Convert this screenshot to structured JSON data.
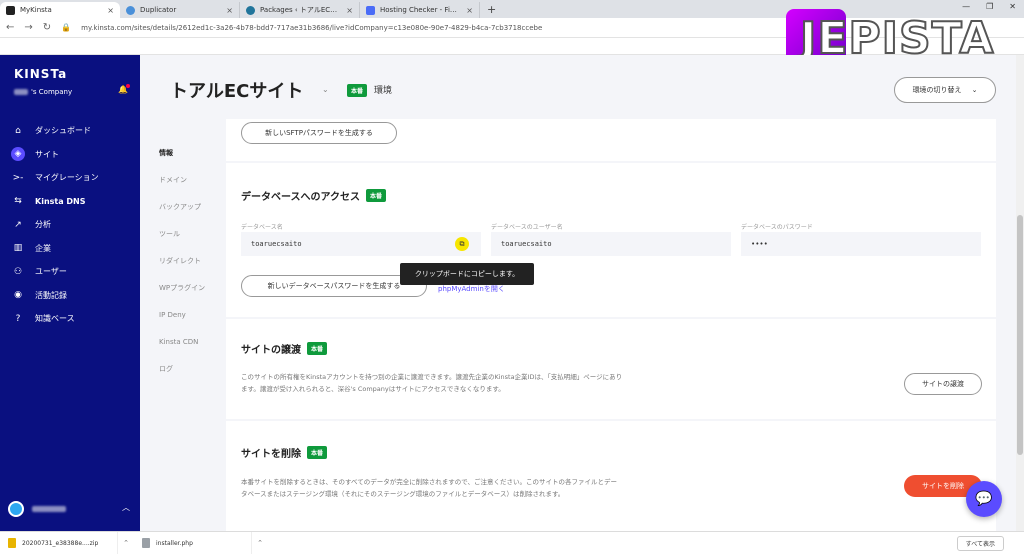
{
  "browser": {
    "tabs": [
      {
        "title": "MyKinsta",
        "color": "#222222"
      },
      {
        "title": "Duplicator",
        "color": "#4a90d9"
      },
      {
        "title": "Packages ‹ トアルECサイト — Wor...",
        "color": "#21759b"
      },
      {
        "title": "Hosting Checker - Find out who ...",
        "color": "#4a6cf7"
      }
    ],
    "new_tab": "+",
    "url": "my.kinsta.com/sites/details/2612ed1c-3a26-4b78-bdd7-717ae31b3686/live?idCompany=c13e080e-90e7-4829-b4ca-7cb3718ccebe"
  },
  "watermark": "JEPISTA",
  "sidebar": {
    "logo": "KINSTa",
    "company_suffix": "'s Company",
    "items": [
      {
        "label": "ダッシュボード",
        "icon": "home-icon",
        "glyph": "⌂"
      },
      {
        "label": "サイト",
        "icon": "layers-icon",
        "glyph": "◈"
      },
      {
        "label": "マイグレーション",
        "icon": "migration-icon",
        "glyph": ">-"
      },
      {
        "label": "Kinsta DNS",
        "icon": "dns-icon",
        "glyph": "⇆"
      },
      {
        "label": "分析",
        "icon": "analytics-icon",
        "glyph": "↗"
      },
      {
        "label": "企業",
        "icon": "building-icon",
        "glyph": "▥"
      },
      {
        "label": "ユーザー",
        "icon": "user-add-icon",
        "glyph": "⚇"
      },
      {
        "label": "活動記録",
        "icon": "eye-icon",
        "glyph": "◉"
      },
      {
        "label": "知識ベース",
        "icon": "help-icon",
        "glyph": "?"
      }
    ]
  },
  "header": {
    "site_name": "トアルECサイト",
    "badge": "本番",
    "env_label": "環境",
    "switch_button": "環境の切り替え"
  },
  "subnav": [
    "情報",
    "ドメイン",
    "バックアップ",
    "ツール",
    "リダイレクト",
    "WPプラグイン",
    "IP Deny",
    "Kinsta CDN",
    "ログ"
  ],
  "sftp": {
    "button": "新しいSFTPパスワードを生成する"
  },
  "database": {
    "title": "データベースへのアクセス",
    "badge": "本番",
    "name_label": "データベース名",
    "name_value": "toaruecsaito",
    "user_label": "データベースのユーザー名",
    "user_value": "toaruecsaito",
    "password_label": "データベースのパスワード",
    "password_value": "••••",
    "tooltip": "クリップボードにコピーします。",
    "new_password_button": "新しいデータベースパスワードを生成する",
    "phpmyadmin_link": "phpMyAdminを開く"
  },
  "transfer": {
    "title": "サイトの譲渡",
    "badge": "本番",
    "desc_line1": "このサイトの所有権をKinstaアカウントを持つ別の企業に譲渡できます。譲渡先企業のKinsta企業IDは、「支払明細」ページにあり",
    "desc_line2": "ます。譲渡が受け入れられると、深谷's Companyはサイトにアクセスできなくなります。",
    "button": "サイトの譲渡"
  },
  "delete": {
    "title": "サイトを削除",
    "badge": "本番",
    "desc_line1": "本番サイトを削除するときは、そのすべてのデータが完全に削除されますので、ご注意ください。このサイトの各ファイルとデー",
    "desc_line2": "タベースまたはステージング環境（それにそのステージング環境のファイルとデータベース）は削除されます。",
    "button": "サイトを削除"
  },
  "downloads": {
    "items": [
      {
        "name": "20200731_e38388e....zip",
        "color": "#e8b400"
      },
      {
        "name": "installer.php",
        "color": "#9aa0a6"
      }
    ],
    "show_all": "すべて表示"
  },
  "colors": {
    "sidebar": "#0a1080",
    "accent": "#5b4cff",
    "badge_green": "#0f9a3c",
    "danger": "#ef4e30"
  }
}
